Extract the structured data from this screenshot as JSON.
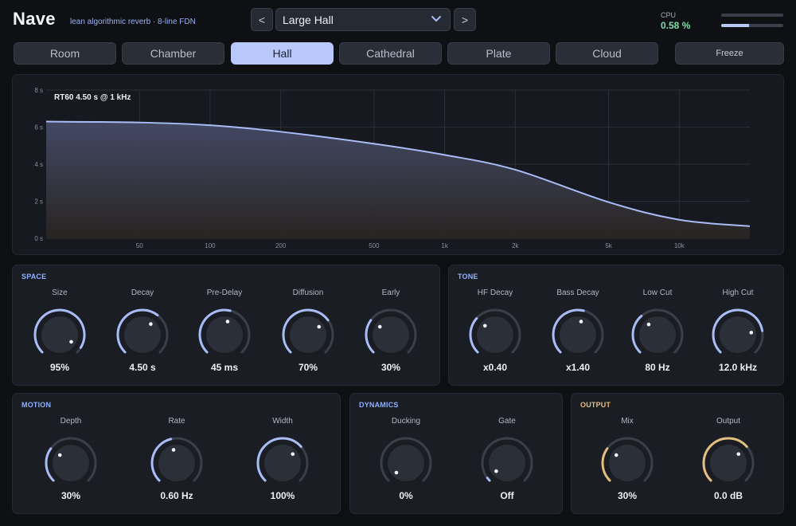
{
  "header": {
    "title": "Nave",
    "subtitle": "lean algorithmic reverb  ·  8-line FDN",
    "prev_label": "<",
    "next_label": ">",
    "preset": "Large Hall",
    "cpu_label": "CPU",
    "cpu_value": "0.58 %",
    "meters": [
      0.0,
      0.45
    ]
  },
  "tabs": [
    {
      "label": "Room",
      "active": false
    },
    {
      "label": "Chamber",
      "active": false
    },
    {
      "label": "Hall",
      "active": true
    },
    {
      "label": "Cathedral",
      "active": false
    },
    {
      "label": "Plate",
      "active": false
    },
    {
      "label": "Cloud",
      "active": false
    }
  ],
  "freeze_label": "Freeze",
  "graph": {
    "rt_label": "RT60 4.50 s @ 1 kHz",
    "y_ticks": [
      "0 s",
      "2 s",
      "4 s",
      "6 s",
      "8 s"
    ],
    "x_ticks": [
      "50",
      "100",
      "200",
      "500",
      "1k",
      "2k",
      "5k",
      "10k"
    ],
    "curve_color": "#a9bcf5"
  },
  "chart_data": {
    "type": "area",
    "xlabel": "",
    "ylabel": "",
    "ylim": [
      0,
      8
    ],
    "x_scale": "log",
    "x": [
      20,
      50,
      100,
      200,
      500,
      1000,
      2000,
      5000,
      10000,
      20000
    ],
    "y": [
      6.3,
      6.25,
      6.1,
      5.75,
      5.1,
      4.5,
      3.7,
      1.95,
      1.0,
      0.65
    ]
  },
  "panels": {
    "space": {
      "title": "SPACE",
      "knobs": [
        {
          "name": "Size",
          "value": "95%",
          "level": 0.95
        },
        {
          "name": "Decay",
          "value": "4.50 s",
          "level": 0.64
        },
        {
          "name": "Pre-Delay",
          "value": "45 ms",
          "level": 0.55
        },
        {
          "name": "Diffusion",
          "value": "70%",
          "level": 0.7
        },
        {
          "name": "Early",
          "value": "30%",
          "level": 0.3
        }
      ]
    },
    "tone": {
      "title": "TONE",
      "knobs": [
        {
          "name": "HF Decay",
          "value": "x0.40",
          "level": 0.32
        },
        {
          "name": "Bass Decay",
          "value": "x1.40",
          "level": 0.55
        },
        {
          "name": "Low Cut",
          "value": "80 Hz",
          "level": 0.35
        },
        {
          "name": "High Cut",
          "value": "12.0 kHz",
          "level": 0.8
        }
      ]
    },
    "motion": {
      "title": "MOTION",
      "knobs": [
        {
          "name": "Depth",
          "value": "30%",
          "level": 0.3
        },
        {
          "name": "Rate",
          "value": "0.60 Hz",
          "level": 0.45
        },
        {
          "name": "Width",
          "value": "100%",
          "level": 0.68
        }
      ]
    },
    "dynamics": {
      "title": "DYNAMICS",
      "knobs": [
        {
          "name": "Ducking",
          "value": "0%",
          "level": 0.0
        },
        {
          "name": "Gate",
          "value": "Off",
          "level": 0.03
        }
      ]
    },
    "output": {
      "title": "OUTPUT",
      "knobs": [
        {
          "name": "Mix",
          "value": "30%",
          "level": 0.3
        },
        {
          "name": "Output",
          "value": "0.0 dB",
          "level": 0.68
        }
      ]
    }
  },
  "colors": {
    "accent": "#a9bcf5",
    "output_accent": "#e3be7e",
    "cpu_ok": "#7fe0a8",
    "track": "#3a3f49",
    "knob_body": "#2b2f37"
  }
}
